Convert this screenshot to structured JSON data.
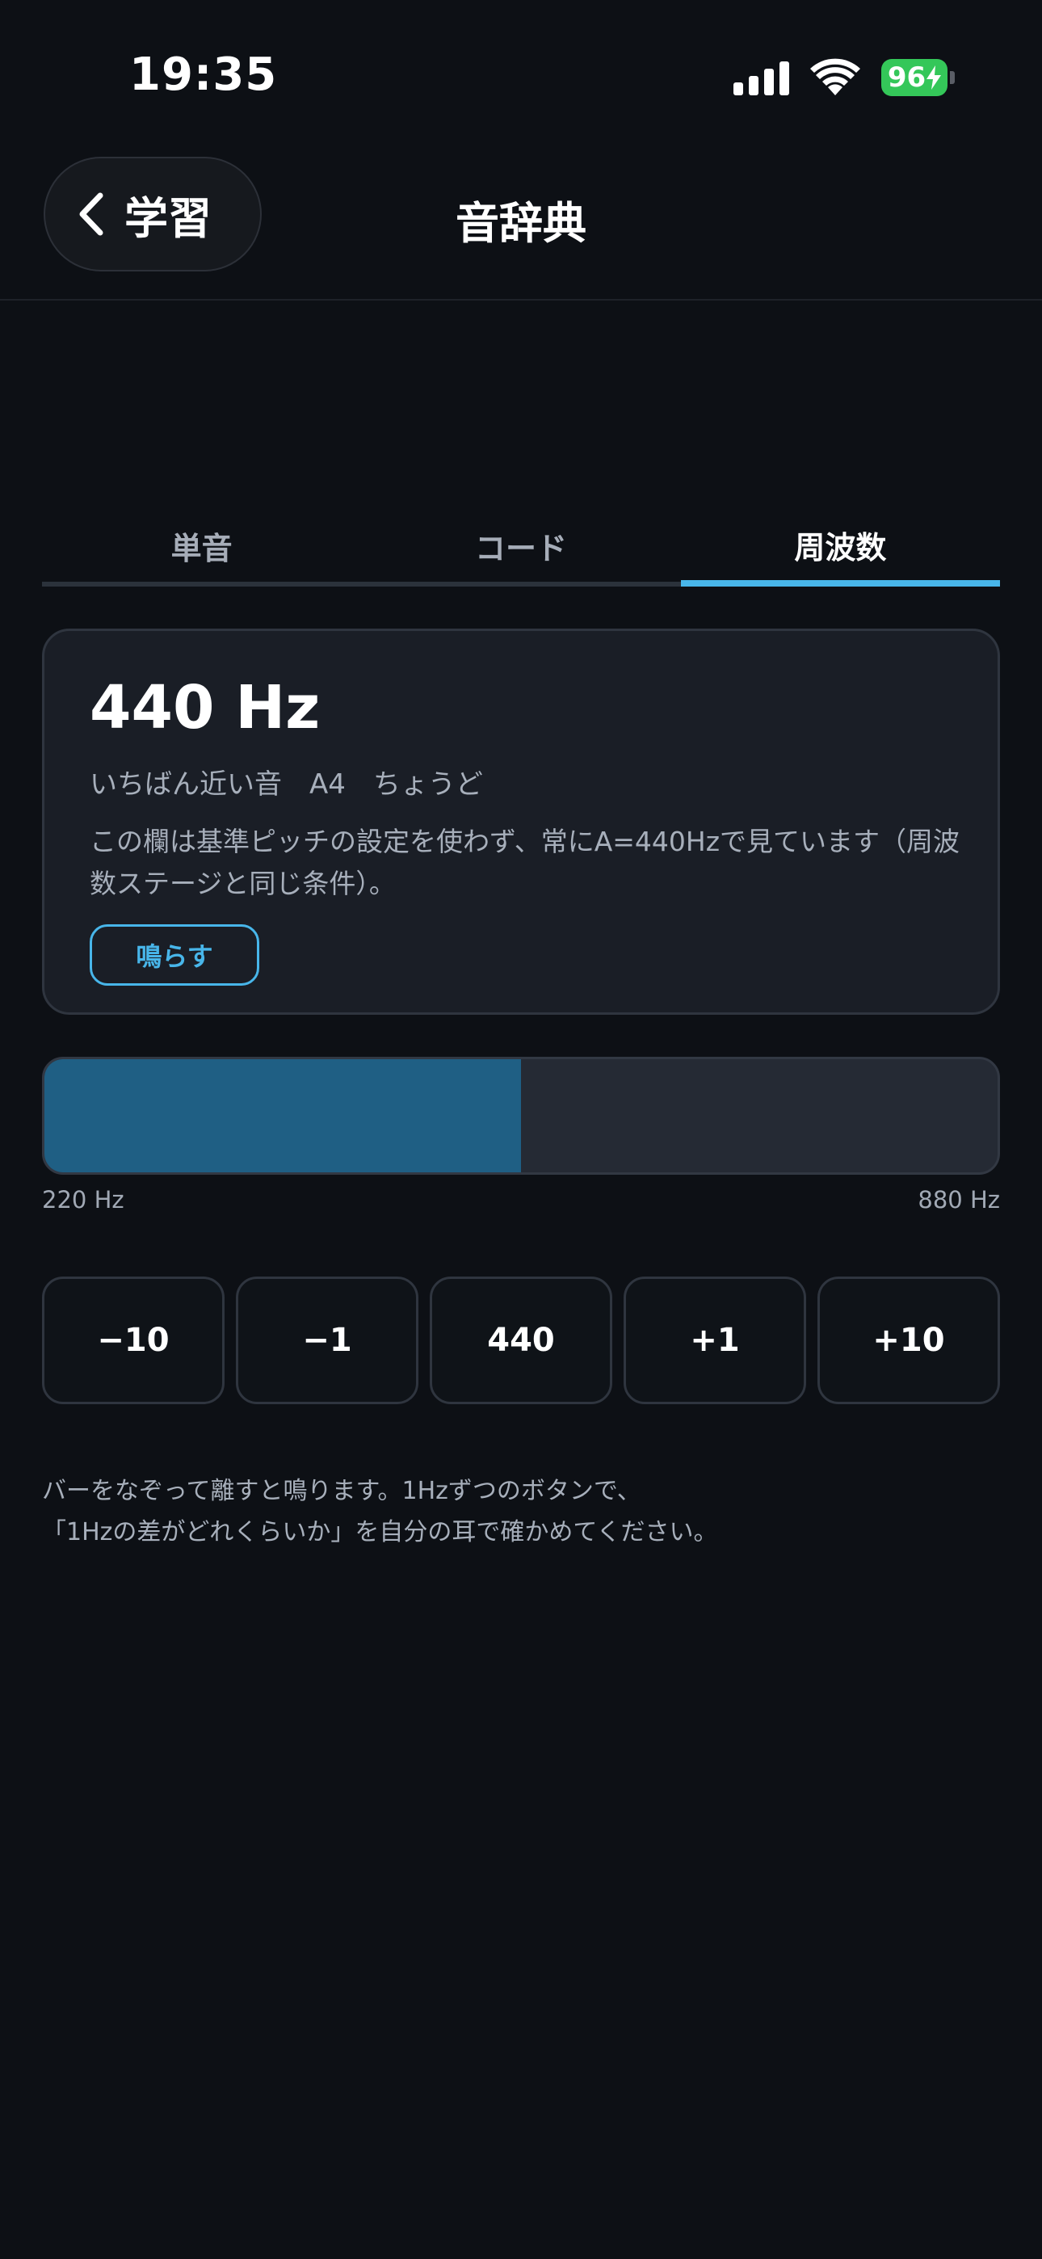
{
  "status_bar": {
    "time": "19:35",
    "battery_level": "96",
    "icons": [
      "cellular-signal-icon",
      "wifi-icon",
      "battery-charging-icon"
    ]
  },
  "nav": {
    "back_label": "学習",
    "title": "音辞典"
  },
  "tabs": [
    {
      "label": "単音",
      "active": false
    },
    {
      "label": "コード",
      "active": false
    },
    {
      "label": "周波数",
      "active": true
    }
  ],
  "card": {
    "frequency": "440 Hz",
    "nearest_label": "いちばん近い音",
    "nearest_note": "A4",
    "nearest_status": "ちょうど",
    "note": "この欄は基準ピッチの設定を使わず、常にA=440Hzで見ています（周波数ステージと同じ条件）。",
    "play_label": "鳴らす"
  },
  "bar": {
    "min_label": "220 Hz",
    "max_label": "880 Hz",
    "fill_fraction": 0.5
  },
  "step_buttons": [
    "−10",
    "−1",
    "440",
    "+1",
    "+10"
  ],
  "help": {
    "line1": "バーをなぞって離すと鳴ります。1Hzずつのボタンで、",
    "line2": "「1Hzの差がどれくらいか」を自分の耳で確かめてください。"
  },
  "colors": {
    "accent": "#48b6ea",
    "bar_fill": "#1f5f84",
    "battery": "#34c759"
  }
}
